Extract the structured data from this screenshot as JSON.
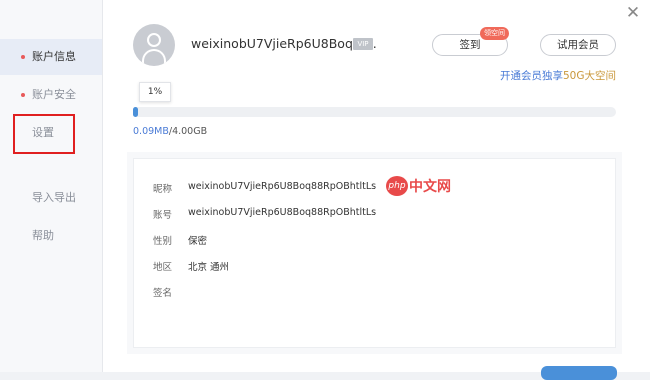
{
  "sidebar": {
    "items": [
      {
        "label": "账户信息"
      },
      {
        "label": "账户安全"
      },
      {
        "label": "设置"
      },
      {
        "label": "导入导出"
      },
      {
        "label": "帮助"
      }
    ]
  },
  "profile": {
    "username": "weixinobU7VjieRp6U8Boq88..",
    "vip_badge": "VIP",
    "sign_in_button": "签到",
    "sign_in_tag": "领空间",
    "trial_member_button": "试用会员",
    "promo_text": "开通会员独享",
    "promo_highlight": "50G大空间"
  },
  "storage": {
    "percent_label": "1%",
    "percent_value": 1,
    "used": "0.09MB",
    "total": "/4.00GB"
  },
  "info": {
    "nickname_label": "昵称",
    "nickname_value": "weixinobU7VjieRp6U8Boq88RpOBhtltLs",
    "account_label": "账号",
    "account_value": "weixinobU7VjieRp6U8Boq88RpOBhtltLs",
    "gender_label": "性别",
    "gender_value": "保密",
    "region_label": "地区",
    "region_value": "北京 通州",
    "signature_label": "签名",
    "signature_value": ""
  },
  "watermark": {
    "logo_text": "php",
    "text": "中文网"
  },
  "colors": {
    "accent_blue": "#4a90d9",
    "link_blue": "#4a7bd6",
    "gold": "#c9973a",
    "highlight_red": "#e02020"
  }
}
